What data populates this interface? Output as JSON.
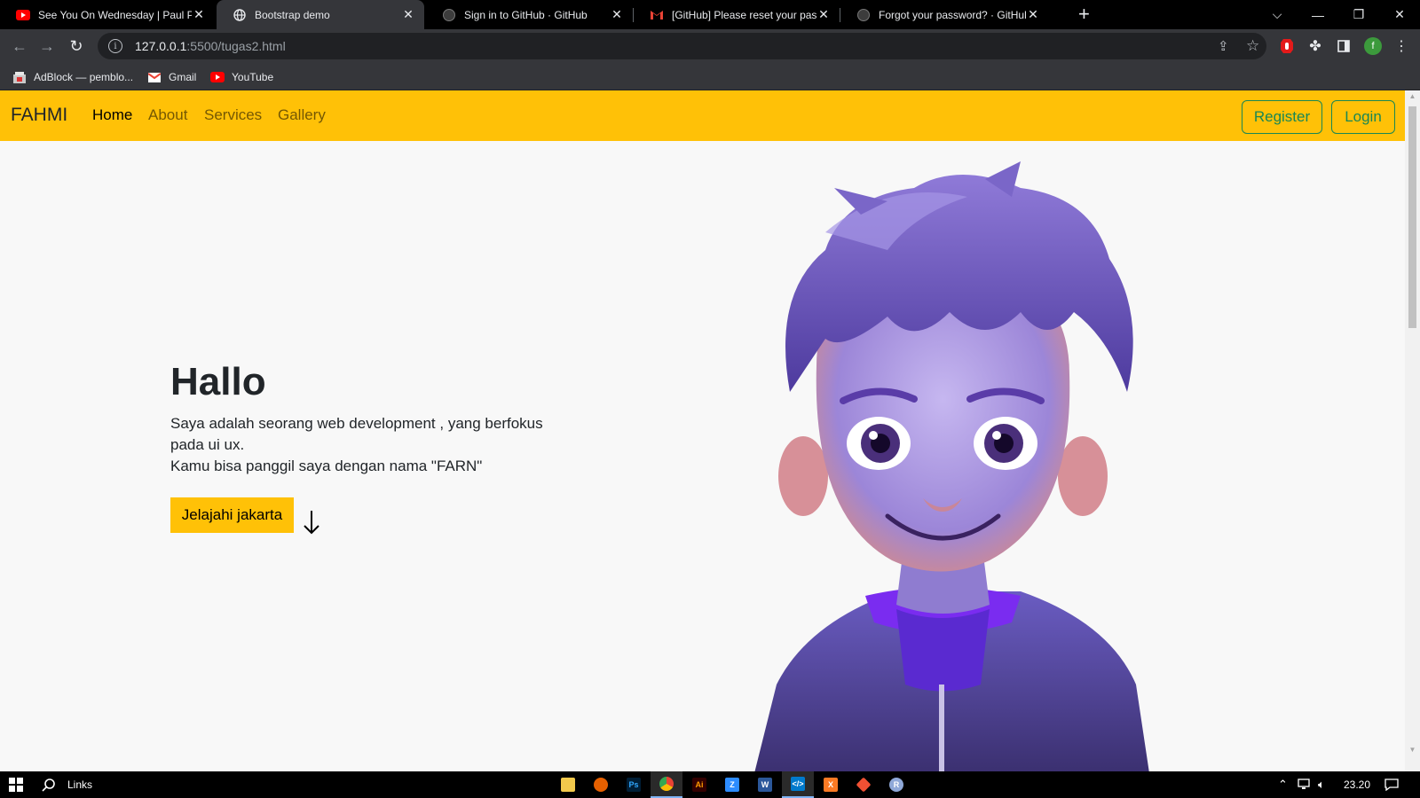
{
  "browser": {
    "tabs": [
      {
        "title": "See You On Wednesday | Paul Pa",
        "favicon": "youtube-icon",
        "active": false
      },
      {
        "title": "Bootstrap demo",
        "favicon": "globe-icon",
        "active": true
      },
      {
        "title": "Sign in to GitHub · GitHub",
        "favicon": "github-icon",
        "active": false
      },
      {
        "title": "[GitHub] Please reset your passw",
        "favicon": "gmail-icon",
        "active": false
      },
      {
        "title": "Forgot your password? · GitHub",
        "favicon": "github-icon",
        "active": false
      }
    ],
    "url_host": "127.0.0.1",
    "url_path": ":5500/tugas2.html",
    "profile_initial": "f",
    "bookmarks": [
      {
        "label": "AdBlock — pemblo...",
        "icon": "adblock-icon"
      },
      {
        "label": "Gmail",
        "icon": "gmail-icon"
      },
      {
        "label": "YouTube",
        "icon": "youtube-icon"
      }
    ]
  },
  "navbar": {
    "brand": "FAHMI",
    "links": [
      "Home",
      "About",
      "Services",
      "Gallery"
    ],
    "active_link": "Home",
    "register_label": "Register",
    "login_label": "Login",
    "accent_color": "#ffc107",
    "button_color": "#198754"
  },
  "hero": {
    "title": "Hallo",
    "line1": "Saya adalah seorang web development , yang berfokus pada ui ux.",
    "line2": "Kamu bisa panggil saya dengan nama \"FARN\"",
    "button_label": "Jelajahi jakarta",
    "arrow_icon": "arrow-down-icon",
    "image": "cartoon-boy-avatar"
  },
  "taskbar": {
    "search_label": "Links",
    "time": "23.20",
    "apps": [
      "file-explorer-icon",
      "firefox-icon",
      "photoshop-icon",
      "chrome-icon",
      "illustrator-icon",
      "zoom-icon",
      "word-icon",
      "vscode-icon",
      "xampp-icon",
      "git-icon",
      "r-icon"
    ]
  }
}
